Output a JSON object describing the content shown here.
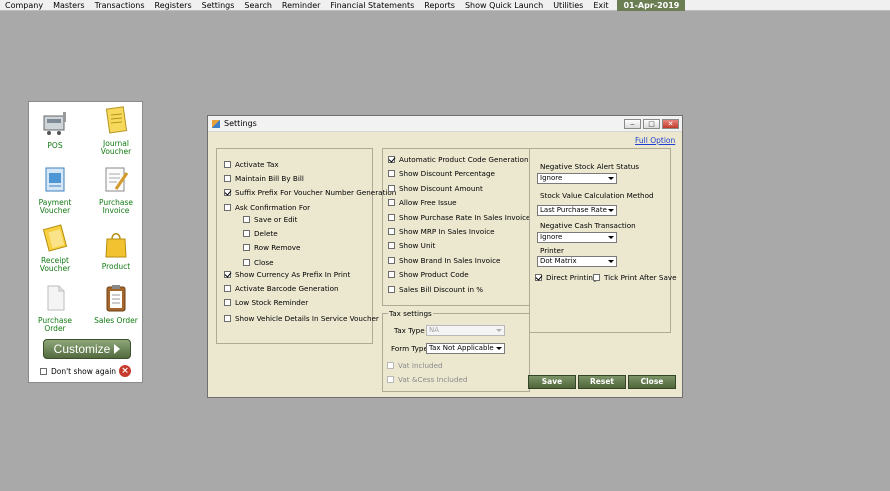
{
  "menubar": {
    "items": [
      "Company",
      "Masters",
      "Transactions",
      "Registers",
      "Settings",
      "Search",
      "Reminder",
      "Financial Statements",
      "Reports",
      "Show Quick Launch",
      "Utilities",
      "Exit"
    ],
    "date": "01-Apr-2019"
  },
  "shortcuts": {
    "pos": "POS",
    "journal_voucher": "Journal Voucher",
    "payment_voucher": "Payment Voucher",
    "purchase_invoice": "Purchase Invoice",
    "receipt_voucher": "Receipt Voucher",
    "product": "Product",
    "purchase_order": "Purchase Order",
    "sales_order": "Sales Order",
    "customize": "Customize",
    "dont_show": "Don't show again"
  },
  "settings": {
    "title": "Settings",
    "full_option": "Full Option",
    "col1": {
      "activate_tax": "Activate Tax",
      "maintain_bill": "Maintain Bill By Bill",
      "suffix_prefix": "Suffix Prefix For Voucher Number Generation",
      "ask_confirmation": "Ask Confirmation For",
      "save_or_edit": "Save or Edit",
      "delete": "Delete",
      "row_remove": "Row Remove",
      "close": "Close",
      "show_currency": "Show Currency As Prefix In Print",
      "activate_barcode": "Activate Barcode Generation",
      "low_stock": "Low Stock Reminder",
      "show_vehicle": "Show Vehicle Details In Service Voucher"
    },
    "col2": {
      "auto_product_code": "Automatic Product Code Generation",
      "show_discount_pct": "Show Discount Percentage",
      "show_discount_amt": "Show Discount Amount",
      "allow_free_issue": "Allow Free Issue",
      "show_purchase_rate": "Show Purchase Rate In Sales Invoice",
      "show_mrp": "Show MRP In Sales Invoice",
      "show_unit": "Show Unit",
      "show_brand": "Show Brand In Sales Invoice",
      "show_product_code": "Show Product Code",
      "sales_bill_discount": "Sales Bill Discount in %"
    },
    "tax": {
      "group_title": "Tax settings",
      "tax_type_label": "Tax Type",
      "tax_type_value": "NA",
      "form_type_label": "Form Type",
      "form_type_value": "Tax Not Applicable",
      "vat_included": "Vat Included",
      "vat_cess": "Vat &Cess Included"
    },
    "col3": {
      "neg_stock_label": "Negative Stock Alert Status",
      "neg_stock_value": "Ignore",
      "stock_value_label": "Stock Value Calculation  Method",
      "stock_value_value": "Last Purchase Rate",
      "neg_cash_label": "Negative Cash Transaction",
      "neg_cash_value": "Ignore",
      "printer_label": "Printer",
      "printer_value": "Dot Matrix",
      "direct_printing": "Direct Printing",
      "tick_print": "Tick Print After Save"
    },
    "buttons": {
      "save": "Save",
      "reset": "Reset",
      "close": "Close"
    }
  }
}
